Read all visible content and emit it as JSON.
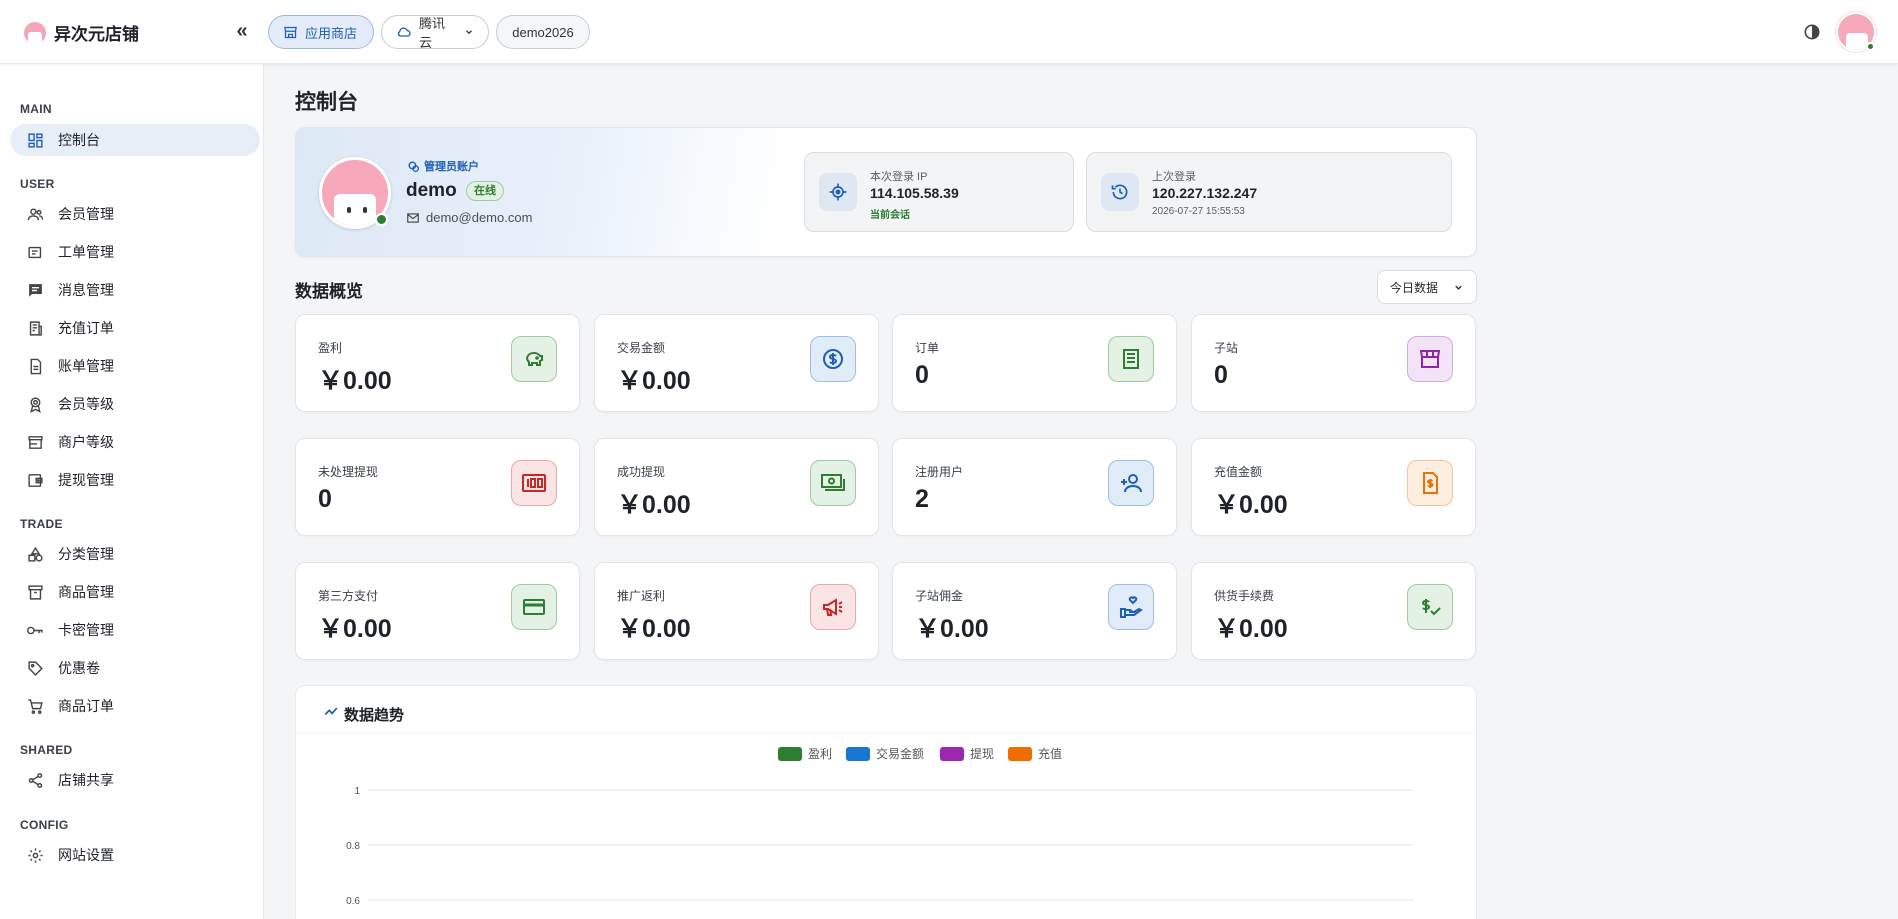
{
  "topbar": {
    "brand": "异次元店铺",
    "chips": {
      "store": "应用商店",
      "cloud": "腾讯云",
      "demo": "demo2026"
    }
  },
  "sidebar": {
    "sections": [
      {
        "title": "MAIN",
        "items": [
          {
            "label": "控制台",
            "icon": "dashboard-icon",
            "active": true
          }
        ]
      },
      {
        "title": "USER",
        "items": [
          {
            "label": "会员管理",
            "icon": "users-icon"
          },
          {
            "label": "工单管理",
            "icon": "ticket-icon"
          },
          {
            "label": "消息管理",
            "icon": "message-icon"
          },
          {
            "label": "充值订单",
            "icon": "recharge-icon"
          },
          {
            "label": "账单管理",
            "icon": "bill-icon"
          },
          {
            "label": "会员等级",
            "icon": "badge-icon"
          },
          {
            "label": "商户等级",
            "icon": "store-icon"
          },
          {
            "label": "提现管理",
            "icon": "wallet-icon"
          }
        ]
      },
      {
        "title": "TRADE",
        "items": [
          {
            "label": "分类管理",
            "icon": "category-icon"
          },
          {
            "label": "商品管理",
            "icon": "archive-icon"
          },
          {
            "label": "卡密管理",
            "icon": "key-icon"
          },
          {
            "label": "优惠卷",
            "icon": "tag-icon"
          },
          {
            "label": "商品订单",
            "icon": "cart-icon"
          }
        ]
      },
      {
        "title": "SHARED",
        "items": [
          {
            "label": "店铺共享",
            "icon": "share-icon"
          }
        ]
      },
      {
        "title": "CONFIG",
        "items": [
          {
            "label": "网站设置",
            "icon": "gear-icon"
          }
        ]
      }
    ]
  },
  "page": {
    "title": "控制台"
  },
  "profile": {
    "admin_tag": "管理员账户",
    "name": "demo",
    "status": "在线",
    "email": "demo@demo.com",
    "current_login": {
      "label": "本次登录 IP",
      "ip": "114.105.58.39",
      "sub": "当前会话"
    },
    "last_login": {
      "label": "上次登录",
      "ip": "120.227.132.247",
      "sub": "2026-07-27 15:55:53"
    }
  },
  "overview": {
    "title": "数据概览",
    "range": "今日数据",
    "stats": [
      {
        "label": "盈利",
        "value": "￥0.00",
        "icon": "piggy-bank-icon",
        "color": "green"
      },
      {
        "label": "交易金额",
        "value": "￥0.00",
        "icon": "dollar-circle-icon",
        "color": "blue"
      },
      {
        "label": "订单",
        "value": "0",
        "icon": "receipt-icon",
        "color": "green"
      },
      {
        "label": "子站",
        "value": "0",
        "icon": "storefront-icon",
        "color": "purple"
      },
      {
        "label": "未处理提现",
        "value": "0",
        "icon": "counter-100-icon",
        "color": "red"
      },
      {
        "label": "成功提现",
        "value": "￥0.00",
        "icon": "cash-icon",
        "color": "green"
      },
      {
        "label": "注册用户",
        "value": "2",
        "icon": "user-add-icon",
        "color": "blue"
      },
      {
        "label": "充值金额",
        "value": "￥0.00",
        "icon": "invoice-dollar-icon",
        "color": "orange"
      },
      {
        "label": "第三方支付",
        "value": "￥0.00",
        "icon": "credit-card-icon",
        "color": "green"
      },
      {
        "label": "推广返利",
        "value": "￥0.00",
        "icon": "megaphone-icon",
        "color": "red"
      },
      {
        "label": "子站佣金",
        "value": "￥0.00",
        "icon": "hand-heart-icon",
        "color": "blue"
      },
      {
        "label": "供货手续费",
        "value": "￥0.00",
        "icon": "dollar-check-icon",
        "color": "green"
      }
    ]
  },
  "trend": {
    "title": "数据趋势"
  },
  "chart_data": {
    "type": "line",
    "title": "",
    "series": [
      {
        "name": "盈利",
        "color": "#2e7d32",
        "values": []
      },
      {
        "name": "交易金额",
        "color": "#1976d2",
        "values": []
      },
      {
        "name": "提现",
        "color": "#9c27b0",
        "values": []
      },
      {
        "name": "充值",
        "color": "#ef6c00",
        "values": []
      }
    ],
    "y_ticks": [
      "1",
      "0.8",
      "0.6"
    ],
    "ylim": [
      0,
      1
    ],
    "grid": true,
    "legend": "top-center"
  }
}
